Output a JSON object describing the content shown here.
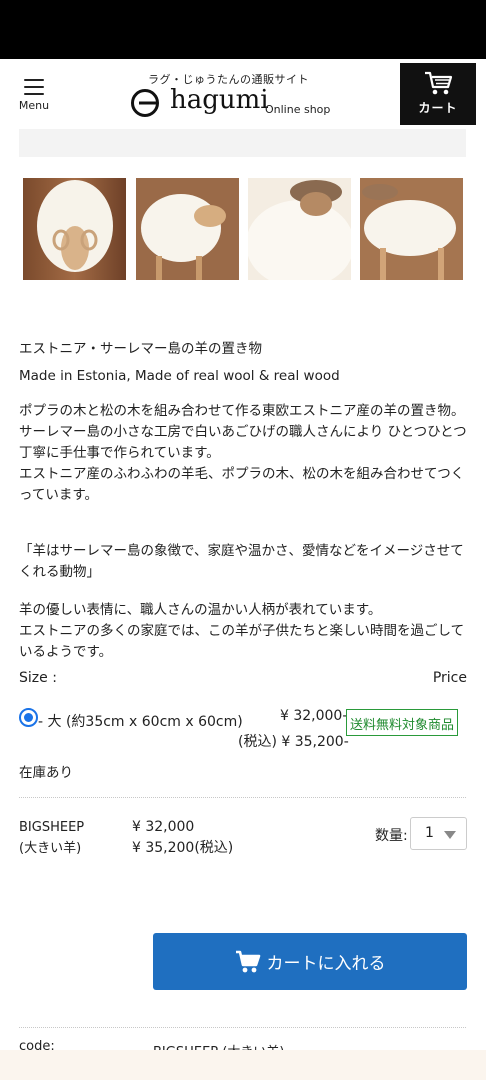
{
  "header": {
    "menu_label": "Menu",
    "tagline": "ラグ・じゅうたんの通販サイト",
    "logo_word": "hagumi",
    "logo_sub": "Online shop",
    "cart_label": "カート",
    "colors": {
      "cart_bg": "#111111"
    }
  },
  "thumbnails": [
    {
      "icon": "sheep-front-photo",
      "label": ""
    },
    {
      "icon": "sheep-side-photo",
      "label": ""
    },
    {
      "icon": "sheep-head-photo",
      "label": ""
    },
    {
      "icon": "sheep-stool-photo",
      "label": ""
    }
  ],
  "product": {
    "title_jp": "エストニア・サーレマー島の羊の置き物",
    "title_en": "Made in Estonia, Made of real wool & real wood",
    "description": "ポプラの木と松の木を組み合わせて作る東欧エストニア産の羊の置き物。\nサーレマー島の小さな工房で白いあごひげの職人さんにより ひとつひとつ丁寧に手仕事で作られています。\nエストニア産のふわふわの羊毛、ポプラの木、松の木を組み合わせてつくっています。",
    "quote": "「羊はサーレマー島の象徴で、家庭や温かさ、愛情などをイメージさせてくれる動物」",
    "description2": "羊の優しい表情に、職人さんの温かい人柄が表れています。\nエストニアの多くの家庭では、この羊が子供たちと楽しい時間を過ごしているようです。"
  },
  "options": {
    "size_label": "Size :",
    "price_label": "Price",
    "item": {
      "label": "- 大 (約35cm x 60cm x 60cm)",
      "price": "¥ 32,000-",
      "price_tax": "(税込) ¥ 35,200-",
      "badge": "送料無料対象商品",
      "selected": true
    },
    "stock": "在庫あり"
  },
  "order": {
    "code": "BIGSHEEP",
    "code_name": "(大きい羊)",
    "price": "¥ 32,000",
    "price_tax": "¥ 35,200(税込)",
    "qty_label": "数量:",
    "qty_value": "1",
    "add_to_cart": "カートに入れる",
    "colors": {
      "button_bg": "#1f6fc0"
    }
  },
  "spec": {
    "code_label": "code:",
    "code_value": "BIGSHEEP (大きい羊)"
  }
}
